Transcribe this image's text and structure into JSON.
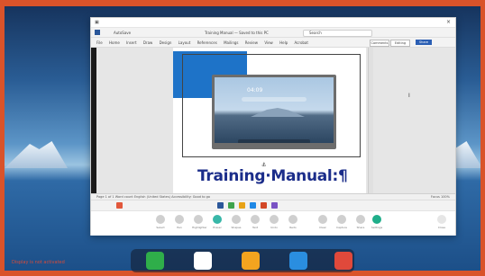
{
  "window": {
    "app_name": "Word",
    "document_title": "Training Manual — Saved to this PC",
    "autosave_label": "AutoSave",
    "search_placeholder": "Search",
    "close_glyph": "×"
  },
  "menu": {
    "items": [
      "File",
      "Home",
      "Insert",
      "Draw",
      "Design",
      "Layout",
      "References",
      "Mailings",
      "Review",
      "View",
      "Help",
      "Acrobat"
    ],
    "comments_label": "Comments",
    "editing_label": "Editing",
    "share_label": "Share"
  },
  "document": {
    "heading": "Training·Manual:¶",
    "embedded_screen_time": "04:09",
    "blue_square_color": "#1e73c8"
  },
  "statusbar": {
    "left": "Page 1 of 1   Word count   English (United States)   Accessibility: Good to go",
    "right": "Focus   100%"
  },
  "whiteboard_tools": {
    "items": [
      {
        "label": "Select",
        "icon": "select-icon"
      },
      {
        "label": "Pen",
        "icon": "pen-icon"
      },
      {
        "label": "Highlighter",
        "icon": "highlighter-icon"
      },
      {
        "label": "Eraser",
        "icon": "eraser-icon"
      },
      {
        "label": "Shapes",
        "icon": "shapes-icon"
      },
      {
        "label": "Text",
        "icon": "text-icon"
      },
      {
        "label": "Undo",
        "icon": "undo-icon"
      },
      {
        "label": "Redo",
        "icon": "redo-icon"
      },
      {
        "label": "Clear",
        "icon": "clear-icon"
      },
      {
        "label": "Capture",
        "icon": "capture-icon"
      },
      {
        "label": "Share",
        "icon": "share-icon"
      },
      {
        "label": "Settings",
        "icon": "settings-icon"
      },
      {
        "label": "Close",
        "icon": "close-icon"
      }
    ]
  },
  "dock": {
    "apps": [
      {
        "name": "Green app",
        "color": "#2fae4a",
        "icon": "green-app-icon"
      },
      {
        "name": "Chrome",
        "color": "#ffffff",
        "icon": "chrome-icon"
      },
      {
        "name": "Yellow app",
        "color": "#f3a41f",
        "icon": "yellow-app-icon"
      },
      {
        "name": "Blue app",
        "color": "#2a8ee0",
        "icon": "blue-app-icon"
      },
      {
        "name": "Red app",
        "color": "#e0493b",
        "icon": "red-app-icon"
      }
    ]
  },
  "corner_note": "Display is not activated"
}
